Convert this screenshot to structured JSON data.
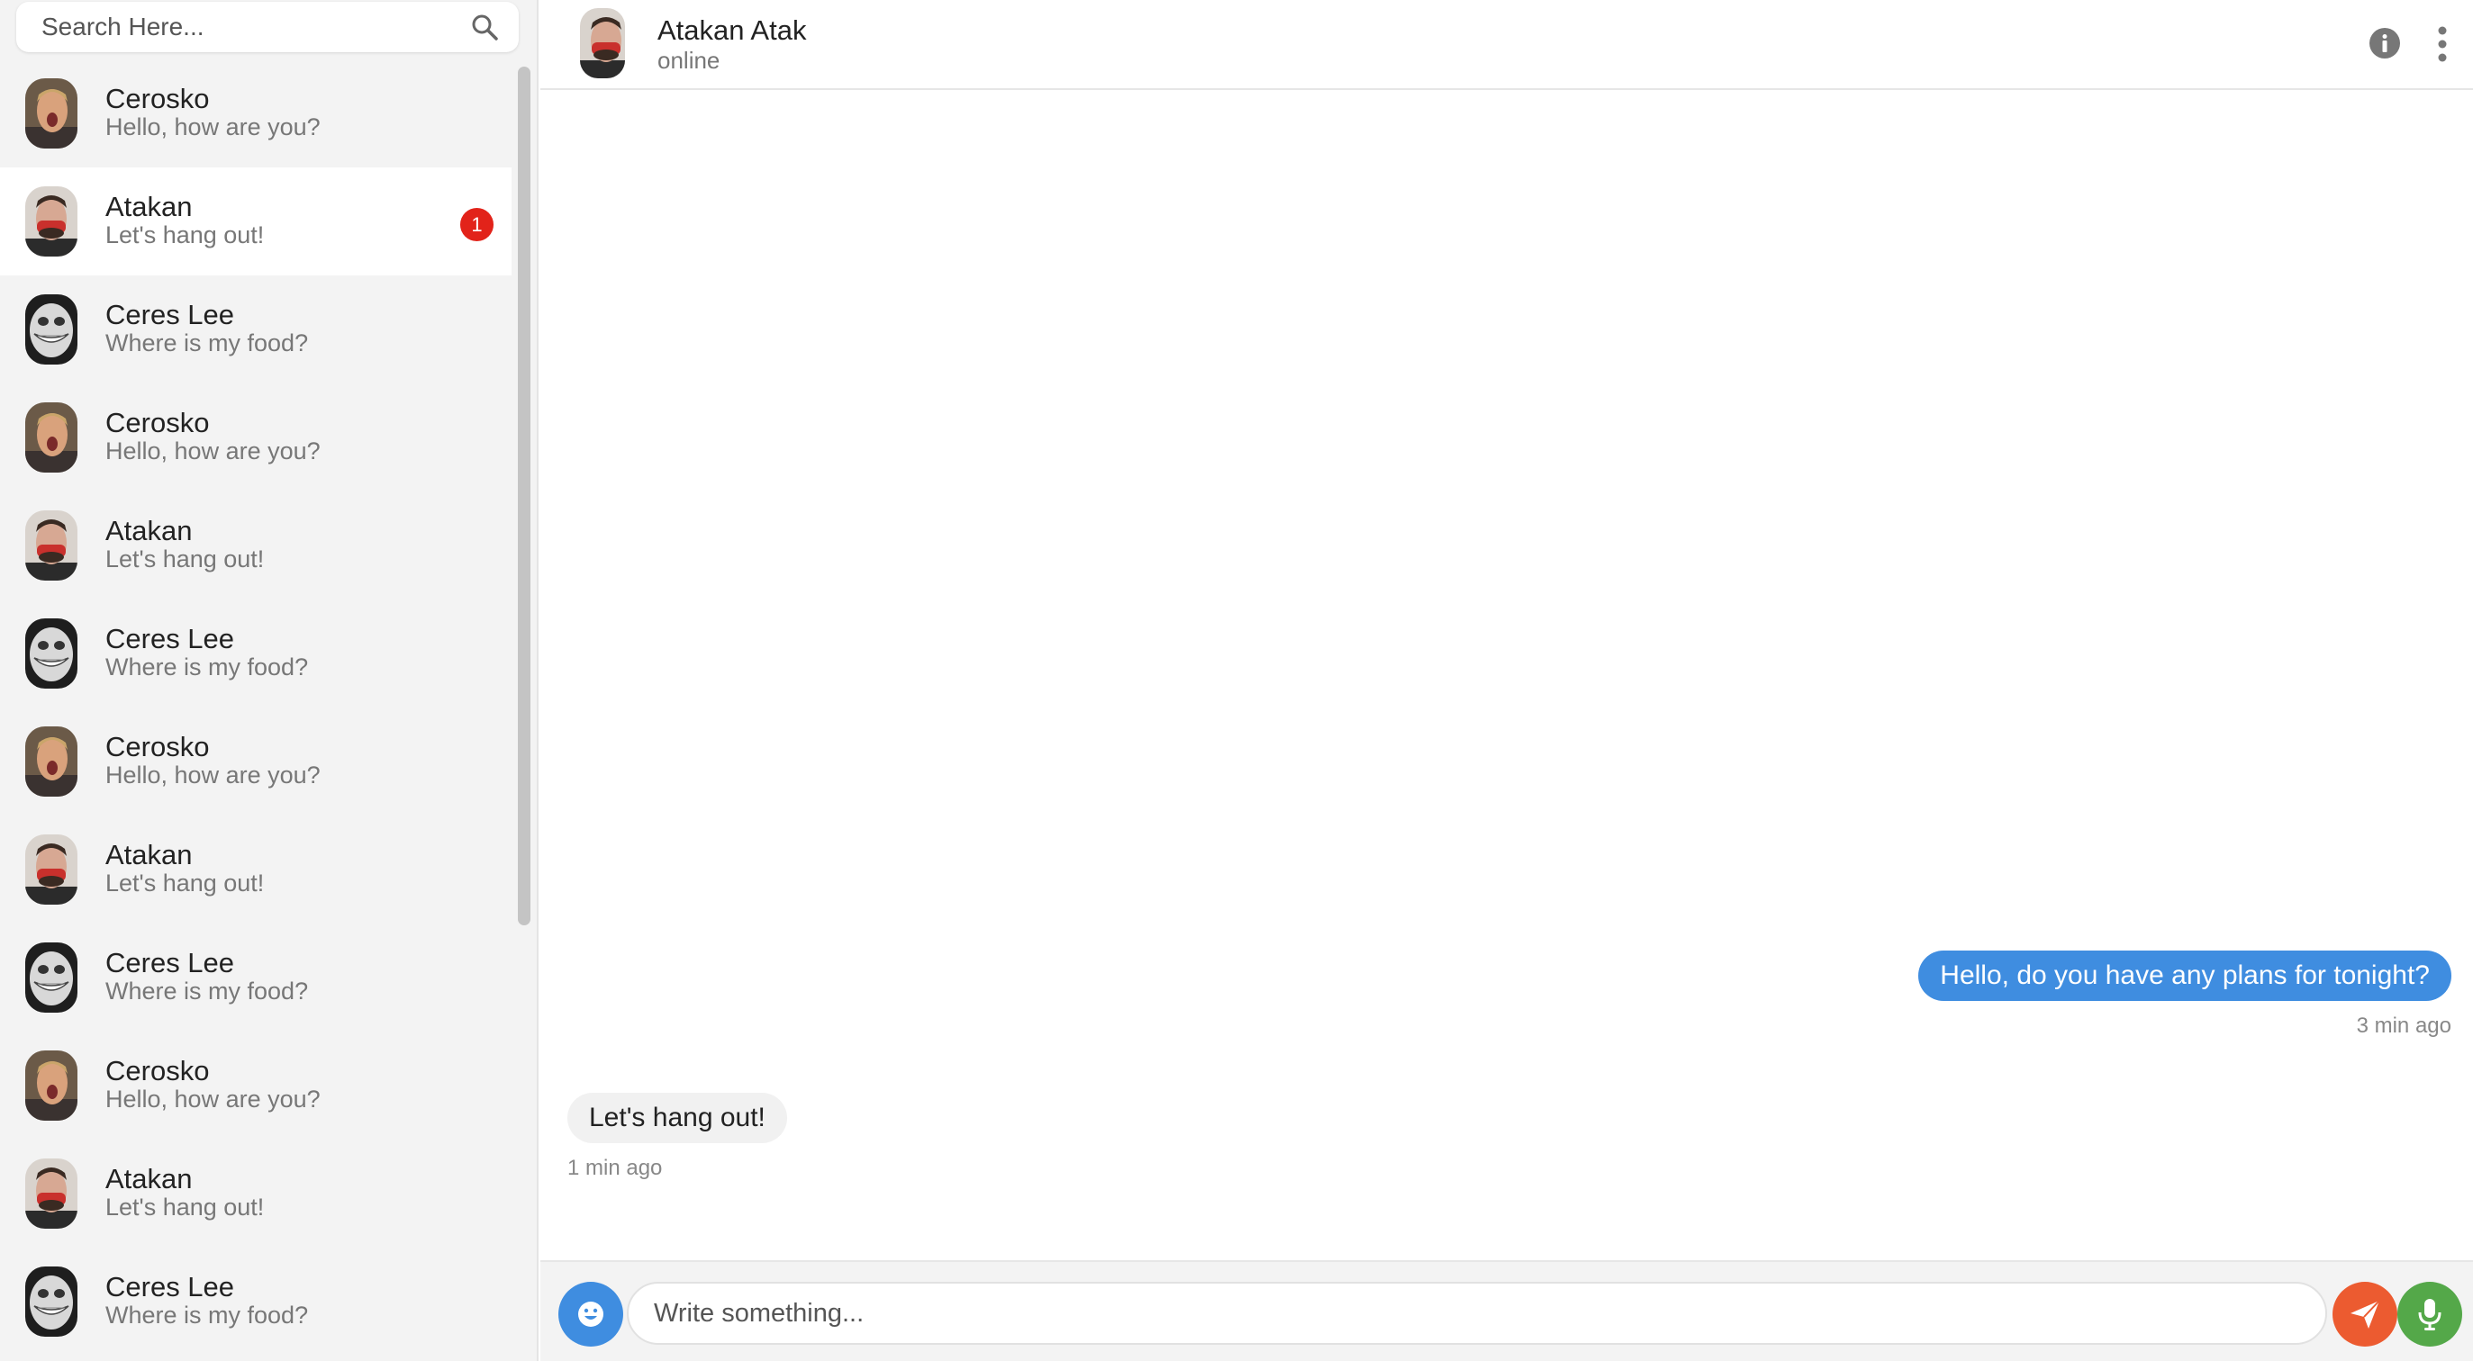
{
  "search": {
    "placeholder": "Search Here...",
    "icon": "search-icon"
  },
  "chats": [
    {
      "name": "Cerosko",
      "preview": "Hello, how are you?",
      "avatar": "cerosko",
      "active": false,
      "unread": ""
    },
    {
      "name": "Atakan",
      "preview": "Let's hang out!",
      "avatar": "atakan",
      "active": true,
      "unread": "1"
    },
    {
      "name": "Ceres Lee",
      "preview": "Where is my food?",
      "avatar": "ceres",
      "active": false,
      "unread": ""
    },
    {
      "name": "Cerosko",
      "preview": "Hello, how are you?",
      "avatar": "cerosko",
      "active": false,
      "unread": ""
    },
    {
      "name": "Atakan",
      "preview": "Let's hang out!",
      "avatar": "atakan",
      "active": false,
      "unread": ""
    },
    {
      "name": "Ceres Lee",
      "preview": "Where is my food?",
      "avatar": "ceres",
      "active": false,
      "unread": ""
    },
    {
      "name": "Cerosko",
      "preview": "Hello, how are you?",
      "avatar": "cerosko",
      "active": false,
      "unread": ""
    },
    {
      "name": "Atakan",
      "preview": "Let's hang out!",
      "avatar": "atakan",
      "active": false,
      "unread": ""
    },
    {
      "name": "Ceres Lee",
      "preview": "Where is my food?",
      "avatar": "ceres",
      "active": false,
      "unread": ""
    },
    {
      "name": "Cerosko",
      "preview": "Hello, how are you?",
      "avatar": "cerosko",
      "active": false,
      "unread": ""
    },
    {
      "name": "Atakan",
      "preview": "Let's hang out!",
      "avatar": "atakan",
      "active": false,
      "unread": ""
    },
    {
      "name": "Ceres Lee",
      "preview": "Where is my food?",
      "avatar": "ceres",
      "active": false,
      "unread": ""
    }
  ],
  "header": {
    "name": "Atakan Atak",
    "status": "online",
    "info_icon": "info-icon",
    "more_icon": "more-vertical-icon"
  },
  "messages": {
    "outgoing": {
      "text": "Hello, do you have any plans for tonight?",
      "time": "3 min ago"
    },
    "incoming": {
      "text": "Let's hang out!",
      "time": "1 min ago"
    }
  },
  "composer": {
    "placeholder": "Write something...",
    "emoji_icon": "emoji-icon",
    "send_icon": "send-icon",
    "mic_icon": "microphone-icon"
  },
  "colors": {
    "accent_blue": "#3f8de0",
    "send_orange": "#ec5b30",
    "mic_green": "#54a849",
    "badge_red": "#e2231a",
    "sidebar_bg": "#f3f3f3"
  }
}
